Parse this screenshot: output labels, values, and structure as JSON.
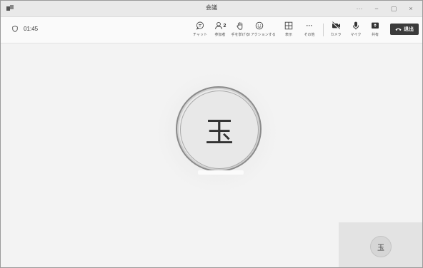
{
  "window": {
    "title": "会議",
    "controls": {
      "more": "···",
      "minimize": "−",
      "maximize": "▢",
      "close": "×"
    }
  },
  "toolbar": {
    "timer": "01:45",
    "items": [
      {
        "id": "chat",
        "label": "チャット",
        "icon": "chat-icon"
      },
      {
        "id": "participants",
        "label": "参加者",
        "icon": "people-icon",
        "badge": "2"
      },
      {
        "id": "raise-hand",
        "label": "手を挙げる",
        "icon": "hand-icon"
      },
      {
        "id": "reactions",
        "label": "リアクションする",
        "icon": "smiley-icon"
      },
      {
        "id": "view",
        "label": "表示",
        "icon": "grid-icon"
      },
      {
        "id": "more",
        "label": "その他",
        "icon": "more-icon",
        "glyph": "···"
      },
      {
        "id": "camera",
        "label": "カメラ",
        "icon": "camera-off-icon"
      },
      {
        "id": "mic",
        "label": "マイク",
        "icon": "mic-icon"
      },
      {
        "id": "share",
        "label": "共有",
        "icon": "share-icon"
      }
    ],
    "leave_label": "退出"
  },
  "stage": {
    "main_avatar_initial": "玉",
    "self_avatar_initial": "玉"
  }
}
